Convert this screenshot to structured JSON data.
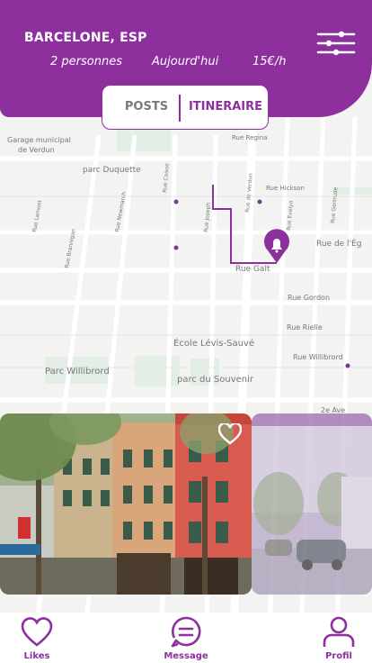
{
  "header": {
    "city": "BARCELONE, ESP",
    "people": "2 personnes",
    "date": "Aujourd'hui",
    "price": "15€/h"
  },
  "tabs": {
    "posts": "POSTS",
    "itinerary": "ITINERAIRE"
  },
  "map": {
    "labels": {
      "garage_1": "Garage municipal",
      "garage_2": "de Verdun",
      "parc_duquette": "parc Duquette",
      "rue_regina": "Rue Regina",
      "rue_hickson": "Rue Hickson",
      "rue_de_l_eg": "Rue de l'Ég",
      "rue_galt": "Rue Galt",
      "rue_gordon": "Rue Gordon",
      "rue_rielle": "Rue Rielle",
      "rue_willibrord": "Rue Willibrord",
      "ecole": "École Lévis-Sauvé",
      "parc_willibrord": "Parc Willibrord",
      "parc_souvenir": "parc du Souvenir",
      "ave_2e": "2e Ave",
      "rue_lamont": "Rue Lamont",
      "rue_brannigan": "Rue Brannigan",
      "rue_newmarch": "Rue Newmarch",
      "rue_caisse": "Rue Caisse",
      "rue_joseph": "Rue Joseph",
      "rue_de_verdun": "Rue de Verdun",
      "rue_evelyn": "Rue Evelyn",
      "rue_gertrude": "Rue Gertrude"
    }
  },
  "nav": {
    "likes": "Likes",
    "message": "Message",
    "profile": "Profil"
  },
  "colors": {
    "accent": "#8e2f9e"
  }
}
